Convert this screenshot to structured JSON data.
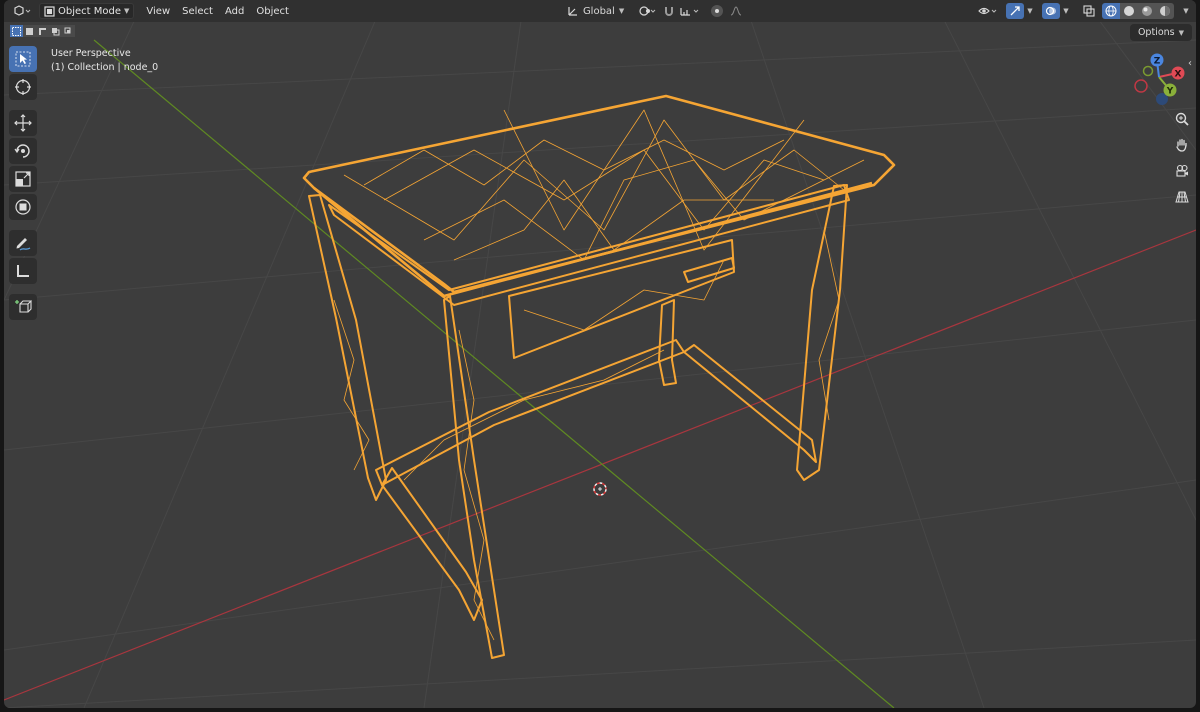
{
  "header": {
    "mode": "Object Mode",
    "menus": [
      "View",
      "Select",
      "Add",
      "Object"
    ],
    "transform_orientation": "Global"
  },
  "overlay": {
    "perspective": "User Perspective",
    "collection": "(1) Collection | node_0"
  },
  "options": {
    "label": "Options"
  },
  "gizmo": {
    "x": "X",
    "y": "Y",
    "z": "Z"
  },
  "colors": {
    "accent": "#4772b3",
    "selected_wire": "#f5a534",
    "viewport_bg": "#3d3d3d",
    "header_bg": "#303030",
    "axis_x": "#b3333f",
    "axis_y": "#6a9a2a"
  }
}
